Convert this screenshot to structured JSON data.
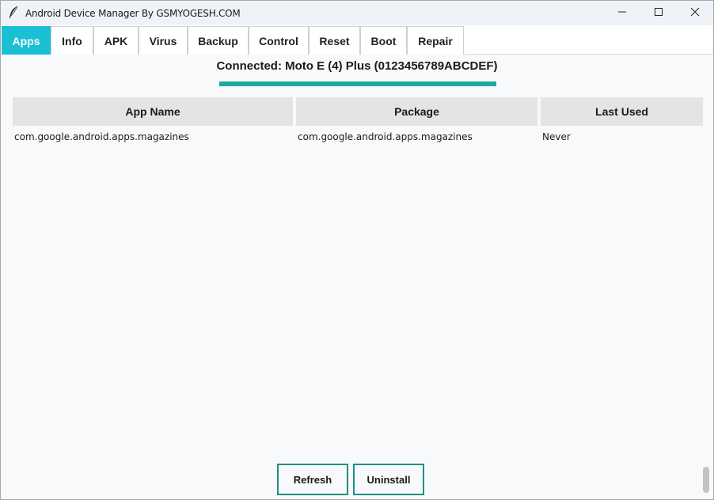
{
  "window": {
    "title": "Android Device Manager By GSMYOGESH.COM",
    "icon": "feather-icon",
    "controls": [
      "minimize-icon",
      "maximize-icon",
      "close-icon"
    ]
  },
  "tabs": [
    {
      "label": "Apps",
      "active": true
    },
    {
      "label": "Info",
      "active": false
    },
    {
      "label": "APK",
      "active": false
    },
    {
      "label": "Virus",
      "active": false
    },
    {
      "label": "Backup",
      "active": false
    },
    {
      "label": "Control",
      "active": false
    },
    {
      "label": "Reset",
      "active": false
    },
    {
      "label": "Boot",
      "active": false
    },
    {
      "label": "Repair",
      "active": false
    }
  ],
  "status": {
    "text": "Connected: Moto E (4) Plus (0123456789ABCDEF)",
    "progress": 1.0
  },
  "table": {
    "columns": [
      "App Name",
      "Package",
      "Last Used"
    ],
    "rows": [
      [
        "com.google.android.apps.magazines",
        "com.google.android.apps.magazines",
        "Never"
      ]
    ]
  },
  "actions": {
    "refresh_label": "Refresh",
    "uninstall_label": "Uninstall"
  },
  "colors": {
    "accent_tab": "#1bbfd3",
    "progress": "#1fa89f",
    "button_border": "#1f8f88"
  }
}
